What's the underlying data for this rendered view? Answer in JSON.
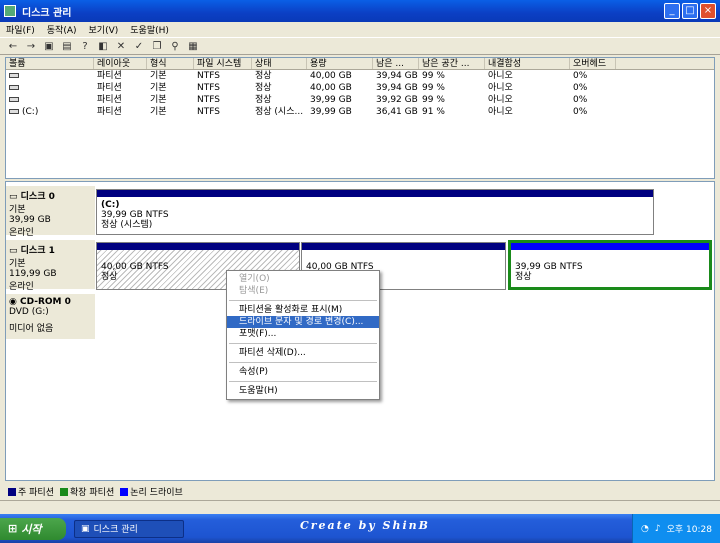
{
  "window": {
    "title": "디스크 관리"
  },
  "menu": [
    "파일(F)",
    "동작(A)",
    "보기(V)",
    "도움말(H)"
  ],
  "table": {
    "columns": [
      "볼륨",
      "레이아웃",
      "형식",
      "파일 시스템",
      "상태",
      "용량",
      "남은 ...",
      "남은 공간 ...",
      "내결함성",
      "오버헤드"
    ],
    "rows": [
      [
        "",
        "파티션",
        "기본",
        "NTFS",
        "정상",
        "40,00 GB",
        "39,94 GB",
        "99 %",
        "아니오",
        "0%"
      ],
      [
        "",
        "파티션",
        "기본",
        "NTFS",
        "정상",
        "40,00 GB",
        "39,94 GB",
        "99 %",
        "아니오",
        "0%"
      ],
      [
        "",
        "파티션",
        "기본",
        "NTFS",
        "정상",
        "39,99 GB",
        "39,92 GB",
        "99 %",
        "아니오",
        "0%"
      ],
      [
        "(C:)",
        "파티션",
        "기본",
        "NTFS",
        "정상 (시스...",
        "39,99 GB",
        "36,41 GB",
        "91 %",
        "아니오",
        "0%"
      ]
    ]
  },
  "disks": [
    {
      "name": "디스크 0",
      "type": "기본",
      "size": "39,99 GB",
      "status": "온라인"
    },
    {
      "name": "디스크 1",
      "type": "기본",
      "size": "119,99 GB",
      "status": "온라인"
    },
    {
      "name": "CD-ROM 0",
      "type": "DVD (G:)",
      "size": "",
      "status": "미디어 없음"
    }
  ],
  "partitions": {
    "d0p0": {
      "label": "(C:)",
      "size": "39,99 GB NTFS",
      "status": "정상 (시스템)"
    },
    "d1p0": {
      "size": "40,00 GB NTFS",
      "status": "정상"
    },
    "d1p1": {
      "size": "40,00 GB NTFS",
      "status": ""
    },
    "d1p2": {
      "size": "39,99 GB NTFS",
      "status": "정상"
    }
  },
  "context_menu": [
    {
      "label": "열기(O)",
      "state": "disabled"
    },
    {
      "label": "탐색(E)",
      "state": "disabled"
    },
    {
      "label": "파티션을 활성화로 표시(M)",
      "state": "normal"
    },
    {
      "label": "드라이브 문자 및 경로 변경(C)...",
      "state": "highlighted"
    },
    {
      "label": "포맷(F)...",
      "state": "normal"
    },
    {
      "label": "파티션 삭제(D)...",
      "state": "normal"
    },
    {
      "label": "속성(P)",
      "state": "normal"
    },
    {
      "label": "도움말(H)",
      "state": "normal"
    }
  ],
  "legend": [
    {
      "label": "주 파티션",
      "color": "#000080"
    },
    {
      "label": "확장 파티션",
      "color": "#1a8a1a"
    },
    {
      "label": "논리 드라이브",
      "color": "#0000ff"
    }
  ],
  "taskbar": {
    "start": "시작",
    "task": "디스크 관리",
    "watermark": "Create by ShinB",
    "clock": "오후 10:28"
  }
}
